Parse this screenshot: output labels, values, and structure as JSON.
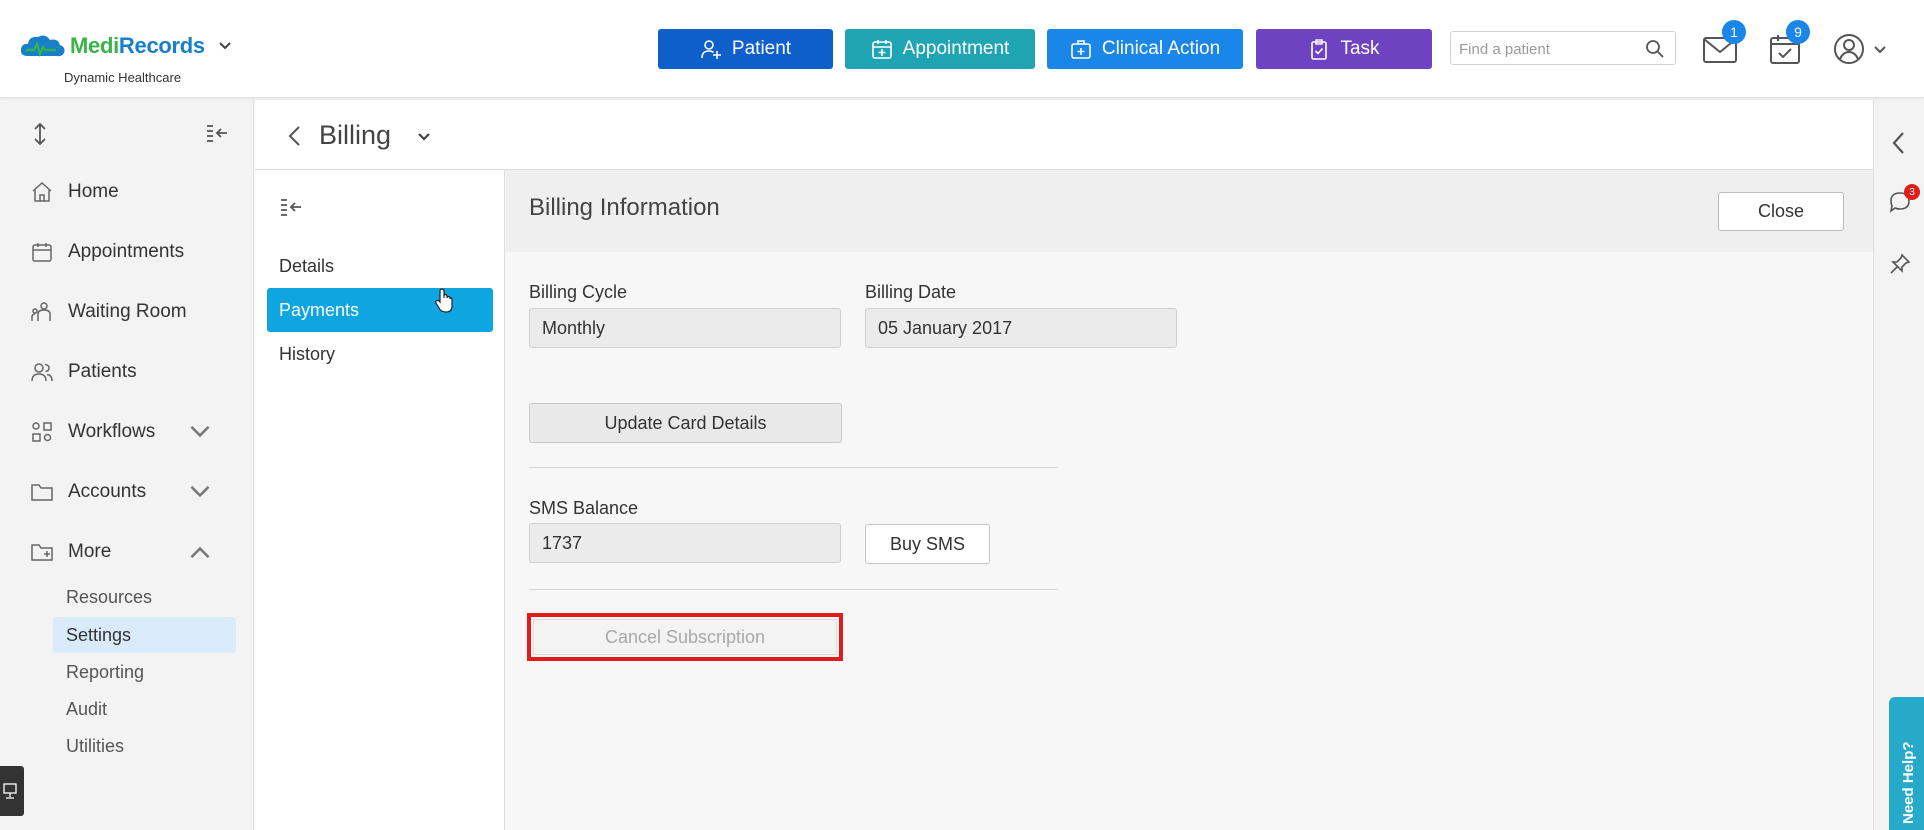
{
  "app": {
    "brand_part1": "Medi",
    "brand_part2": "Records",
    "practice_name": "Dynamic Healthcare"
  },
  "quick_actions": [
    {
      "label": "Patient",
      "color": "#0e5fc9"
    },
    {
      "label": "Appointment",
      "color": "#1ea4b3"
    },
    {
      "label": "Clinical Action",
      "color": "#1a86e8"
    },
    {
      "label": "Task",
      "color": "#6f42c1"
    }
  ],
  "search": {
    "placeholder": "Find a patient"
  },
  "header_icons": {
    "mail_count": "1",
    "calendar_count": "9"
  },
  "sidebar": {
    "items": [
      {
        "label": "Home",
        "icon": "home-icon"
      },
      {
        "label": "Appointments",
        "icon": "calendar-icon"
      },
      {
        "label": "Waiting Room",
        "icon": "waiting-room-icon"
      },
      {
        "label": "Patients",
        "icon": "patients-icon"
      },
      {
        "label": "Workflows",
        "icon": "workflows-icon"
      },
      {
        "label": "Accounts",
        "icon": "folder-icon"
      },
      {
        "label": "More",
        "icon": "folder-plus-icon"
      }
    ],
    "more_children": [
      "Resources",
      "Settings",
      "Reporting",
      "Audit",
      "Utilities"
    ],
    "active_child": "Settings"
  },
  "page": {
    "title": "Billing"
  },
  "tabs": {
    "items": [
      "Details",
      "Payments",
      "History"
    ],
    "active": "Payments"
  },
  "billing": {
    "heading": "Billing Information",
    "close_label": "Close",
    "billing_cycle_label": "Billing Cycle",
    "billing_cycle_value": "Monthly",
    "billing_date_label": "Billing Date",
    "billing_date_value": "05 January 2017",
    "update_card_label": "Update Card Details",
    "sms_balance_label": "SMS Balance",
    "sms_balance_value": "1737",
    "buy_sms_label": "Buy SMS",
    "cancel_subscription_label": "Cancel Subscription"
  },
  "right_rail": {
    "chat_count": "3",
    "help_label": "Need Help?"
  },
  "colors": {
    "active_tab": "#0ea5e0",
    "highlight_border": "#e21b1b",
    "active_subitem": "#d9ebfb"
  }
}
